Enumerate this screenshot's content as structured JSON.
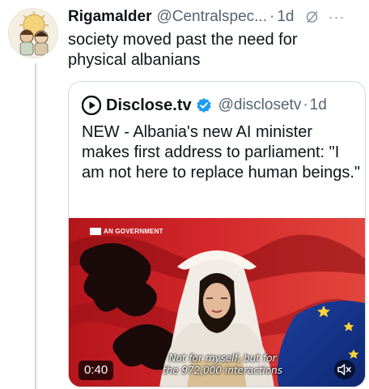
{
  "tweet": {
    "display_name": "Rigamalder",
    "handle": "@Centralspec...",
    "separator": "·",
    "time": "1d",
    "text": "society moved past the need for physical albanians"
  },
  "quote": {
    "display_name": "Disclose.tv",
    "handle": "@disclosetv",
    "separator": "·",
    "time": "1d",
    "text": "NEW - Albania's new AI minister makes first address to parliament: \"I am not here to replace human beings.\"",
    "video": {
      "overlay_label": "AN GOVERNMENT",
      "subtitle_line1": "Not for myself, but for",
      "subtitle_line2": "the 972,000 interactions",
      "duration": "0:40"
    }
  },
  "icons": {
    "grok": "grok-icon",
    "more": "more-icon",
    "source_logo": "play-circle-logo-icon",
    "verified": "verified-badge-icon",
    "mute": "speaker-muted-icon"
  },
  "colors": {
    "verified_blue": "#1d9bf0",
    "secondary_text": "#536471",
    "border": "#cfd9de"
  }
}
